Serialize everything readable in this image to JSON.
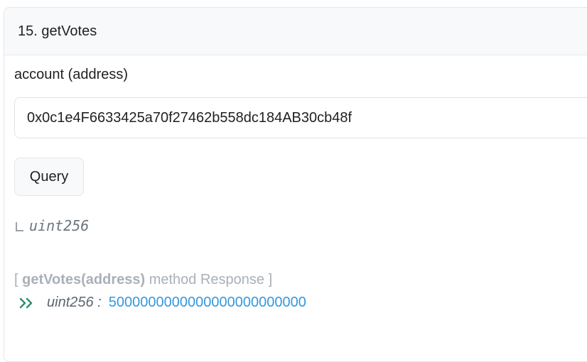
{
  "method": {
    "title": "15. getVotes"
  },
  "input": {
    "label": "account (address)",
    "value": "0x0c1e4F6633425a70f27462b558dc184AB30cb48f"
  },
  "query_button": {
    "label": "Query"
  },
  "returns": {
    "type": "uint256"
  },
  "response": {
    "bracket_open": "[",
    "method_signature": "getVotes(address)",
    "suffix": "method Response ]",
    "type": "uint256 :",
    "value": "5000000000000000000000000"
  },
  "colors": {
    "accent_green": "#2d8f6f",
    "value_blue": "#3498db"
  },
  "icons": {
    "return": "corner-down-right-icon",
    "response": "double-chevron-right-icon"
  }
}
